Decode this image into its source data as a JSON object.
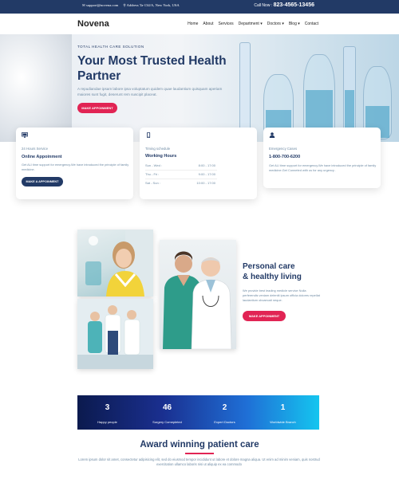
{
  "topbar": {
    "email": "support@novena.com",
    "address": "Address Ta-134/A, New York, USA",
    "call_label": "Call Now :",
    "phone": "823-4565-13456"
  },
  "nav": {
    "logo": "Novena",
    "items": [
      {
        "label": "Home"
      },
      {
        "label": "About"
      },
      {
        "label": "Services"
      },
      {
        "label": "Department",
        "dropdown": true
      },
      {
        "label": "Doctors",
        "dropdown": true
      },
      {
        "label": "Blog",
        "dropdown": true
      },
      {
        "label": "Contact"
      }
    ]
  },
  "hero": {
    "kicker": "TOTAL HEALTH CARE SOLUTION",
    "title": "Your Most Trusted Health Partner",
    "description": "A repudiandae ipsam labore ipsa voluptatum quidem quae laudantium quisquam aperiam maiores sunt fugit, deserunt rem suscipit placeat.",
    "button": "MAKE APPOINMENT"
  },
  "features": [
    {
      "icon": "monitor-icon",
      "small": "24 Hours Service",
      "heading": "Online Appoinment",
      "text": "Get ALl time support for emergency.We have introduced the principle of family medicine.",
      "button": "MAKE A APPOINMENT"
    },
    {
      "icon": "phone-icon",
      "small": "Timing schedule",
      "heading": "Working Hours",
      "hours": [
        {
          "day": "Sun - Wed :",
          "time": "8:00 - 17:00"
        },
        {
          "day": "Thu - Fri :",
          "time": "9:00 - 17:00"
        },
        {
          "day": "Sat - Sun :",
          "time": "10:00 - 17:00"
        }
      ]
    },
    {
      "icon": "person-icon",
      "small": "Emergency Cases",
      "heading": "1-800-700-6200",
      "text": "Get ALl time support for emergency.We have introduced the principle of family medicine.Get Conneted with us for any urgency ."
    }
  ],
  "care": {
    "title_line1": "Personal care",
    "title_line2": "& healthy living",
    "text": "We provide best leading medicle service Nulla perferendis veniam deleniti ipsum officia dolores repellat laudantium obcaecati neque.",
    "button": "MAKE APPOINMENT"
  },
  "stats": [
    {
      "value": "3",
      "label": "Happy people"
    },
    {
      "value": "46",
      "label": "Surgery Comepleted"
    },
    {
      "value": "2",
      "label": "Expert Doctors"
    },
    {
      "value": "1",
      "label": "Worldwide Branch"
    }
  ],
  "award": {
    "title": "Award winning patient care",
    "text": "Lorem ipsum dolor sit amet, consectetur adipisicing elit, sed do eiusmod tempor incididunt ut labore et dolore magna aliqua. Ut enim ad minim veniam, quis nostrud exercitation ullamco laboris nisi ut aliquip ex ea commodo"
  },
  "colors": {
    "primary": "#223a66",
    "accent": "#e12454",
    "muted": "#6f8ba4"
  }
}
